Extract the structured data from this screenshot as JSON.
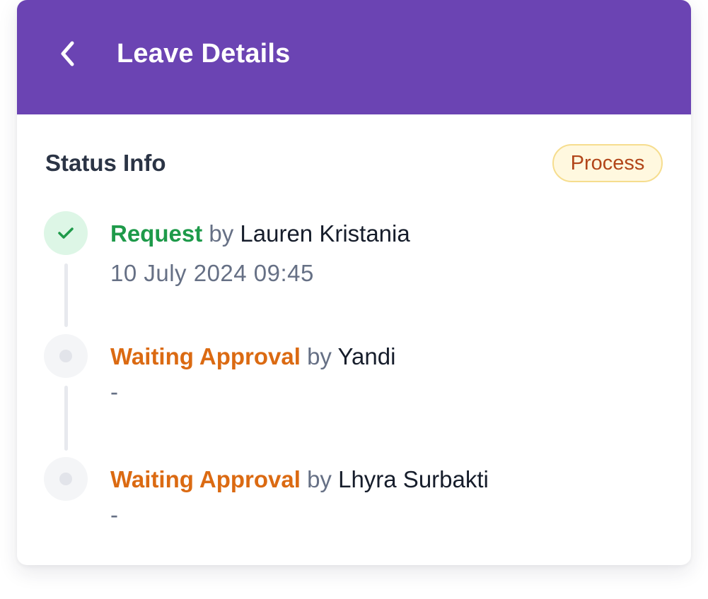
{
  "header": {
    "title": "Leave Details",
    "back_icon": "chevron-left-icon",
    "background_color": "#6b44b3"
  },
  "status_info": {
    "title": "Status Info",
    "badge": "Process",
    "badge_color": "#b2461a"
  },
  "timeline": [
    {
      "status": "Request",
      "state": "done",
      "by_label": "by",
      "actor": "Lauren Kristania",
      "timestamp": "10 July 2024 09:45",
      "icon": "check-icon",
      "status_color": "#1e9a4a"
    },
    {
      "status": "Waiting Approval",
      "state": "pending",
      "by_label": "by",
      "actor": "Yandi",
      "timestamp": "-",
      "icon": "dot-icon",
      "status_color": "#db6a12"
    },
    {
      "status": "Waiting Approval",
      "state": "pending",
      "by_label": "by",
      "actor": "Lhyra Surbakti",
      "timestamp": "-",
      "icon": "dot-icon",
      "status_color": "#db6a12"
    }
  ]
}
